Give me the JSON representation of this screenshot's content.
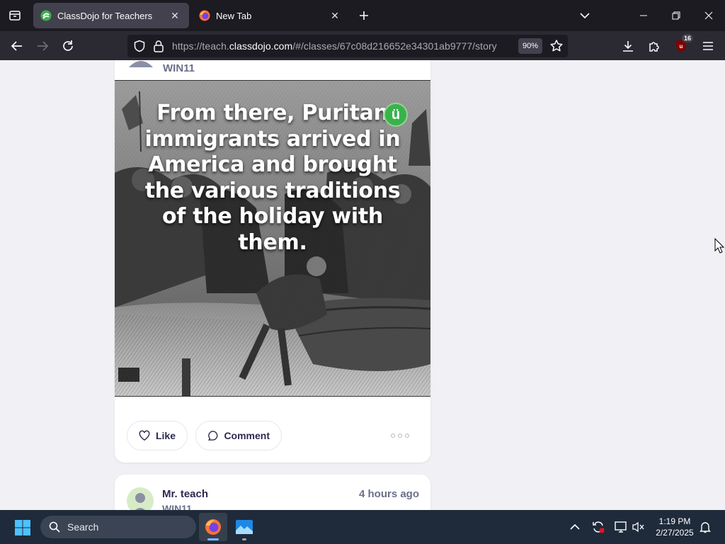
{
  "browser": {
    "tabs": [
      {
        "title": "ClassDojo for Teachers",
        "favicon": "classdojo-icon",
        "active": true
      },
      {
        "title": "New Tab",
        "favicon": "firefox-icon",
        "active": false
      }
    ],
    "url_prefix": "https://teach.",
    "url_host": "classdojo.com",
    "url_path": "/#/classes/67c08d216652e34301ab9777/story",
    "zoom": "90%",
    "extension_badge": "16"
  },
  "post1": {
    "class_name": "WIN11",
    "caption": "From there, Puritan immigrants arrived in America and brought the various traditions of the holiday with them.",
    "badge_glyph": "ü",
    "actions": {
      "like": "Like",
      "comment": "Comment"
    }
  },
  "post2": {
    "teacher": "Mr. teach",
    "time": "4 hours ago",
    "class_name": "WIN11"
  },
  "taskbar": {
    "search_placeholder": "Search",
    "time": "1:19 PM",
    "date": "2/27/2025"
  },
  "colors": {
    "tabbar": "#1c1b22",
    "navbar": "#2b2a33",
    "page_bg": "#f1f1f5",
    "accent_text": "#2c2a50",
    "taskbar": "#1f2b3a"
  }
}
